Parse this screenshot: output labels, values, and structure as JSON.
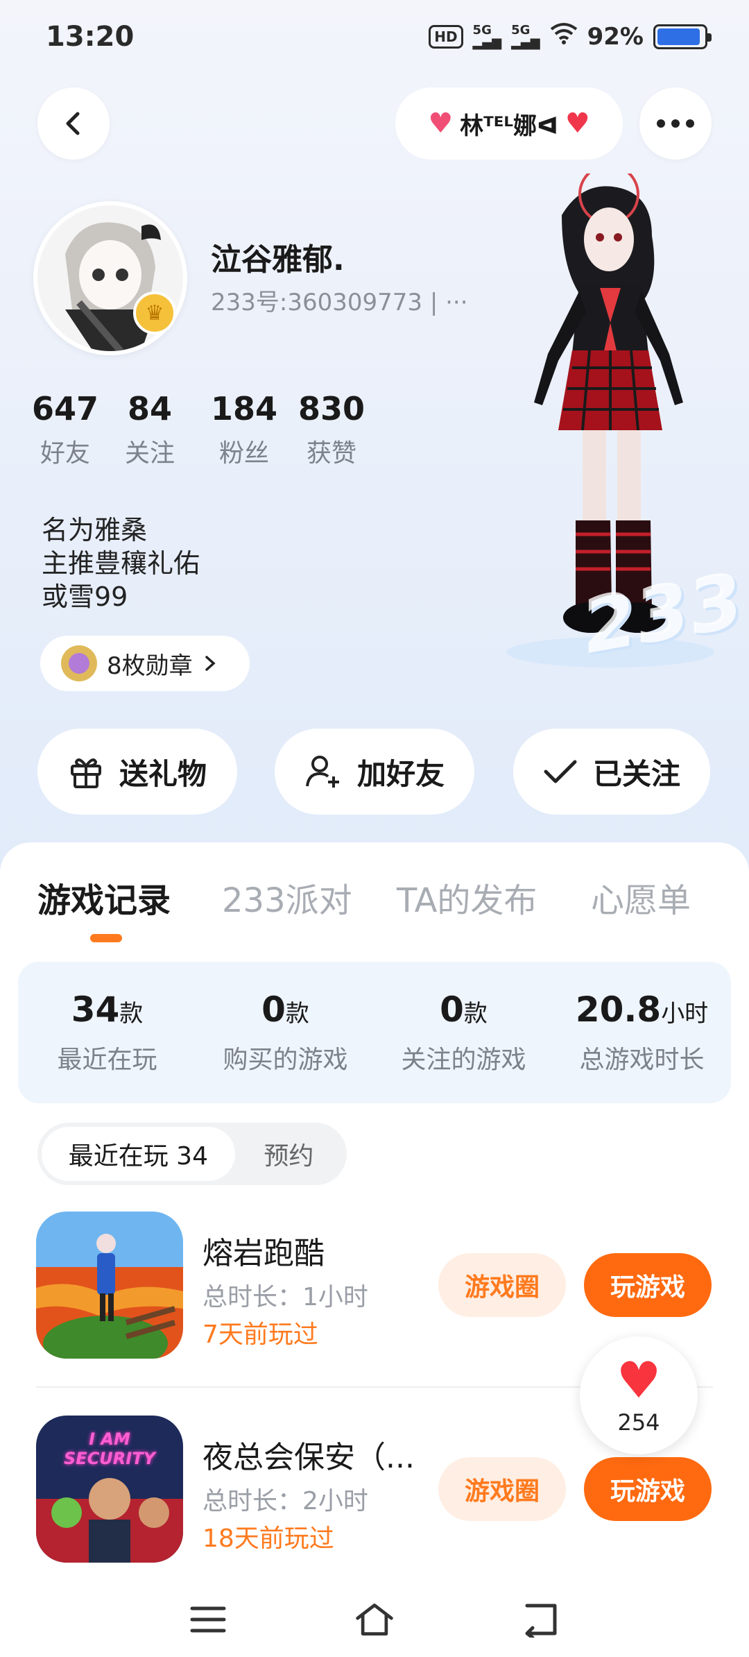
{
  "status": {
    "time": "13:20",
    "hd": "HD",
    "net1": "5G",
    "net2": "5G",
    "battery": "92%",
    "battery_level": 0.92
  },
  "header": {
    "couple_name": "林ᵀᴱᴸ娜ᐊ"
  },
  "profile": {
    "username": "泣谷雅郁.",
    "uid": "233号:360309773 | ···",
    "stats": [
      {
        "value": "647",
        "label": "好友"
      },
      {
        "value": "84",
        "label": "关注"
      },
      {
        "value": "184",
        "label": "粉丝"
      },
      {
        "value": "830",
        "label": "获赞"
      }
    ],
    "bio": [
      "名为雅桑",
      "主推豊穰礼佑",
      "或雪99"
    ],
    "medals": "8枚勋章"
  },
  "actions": {
    "gift": "送礼物",
    "add_friend": "加好友",
    "followed": "已关注"
  },
  "tabs": [
    "游戏记录",
    "233派对",
    "TA的发布",
    "心愿单"
  ],
  "game_stats": [
    {
      "value": "34",
      "unit": "款",
      "label": "最近在玩"
    },
    {
      "value": "0",
      "unit": "款",
      "label": "购买的游戏"
    },
    {
      "value": "0",
      "unit": "款",
      "label": "关注的游戏"
    },
    {
      "value": "20.8",
      "unit": "小时",
      "label": "总游戏时长"
    }
  ],
  "segment": {
    "recent": "最近在玩 34",
    "reserve": "预约"
  },
  "games": [
    {
      "name": "熔岩跑酷",
      "duration": "总时长：1小时",
      "last": "7天前玩过",
      "circle": "游戏圈",
      "play": "玩游戏"
    },
    {
      "name": "夜总会保安（...",
      "duration": "总时长：2小时",
      "last": "18天前玩过",
      "circle": "游戏圈",
      "play": "玩游戏",
      "icon_text": "I AM SECURITY"
    }
  ],
  "likes": "254",
  "logo": "233"
}
